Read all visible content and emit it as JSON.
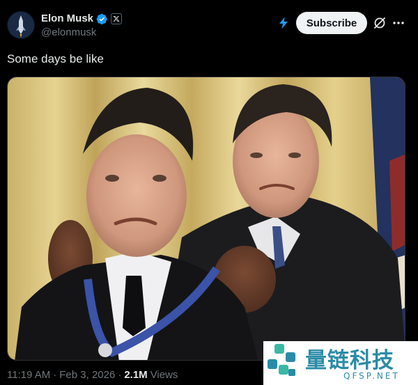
{
  "post": {
    "author": {
      "display_name": "Elon Musk",
      "handle": "@elonmusk",
      "verified_icon": "verified-badge-icon",
      "affiliation_icon": "x-logo-icon"
    },
    "actions": {
      "subscribe_label": "Subscribe",
      "grok_icon": "lightning-bolt-icon",
      "grok_action_icon": "grok-slash-icon",
      "more_icon": "more-dots-icon"
    },
    "text": "Some days be like",
    "media": {
      "description_icon": "photo"
    },
    "meta": {
      "time": "11:19 AM",
      "separator": "·",
      "date": "Feb 3, 2026",
      "views_count": "2.1M",
      "views_label": "Views"
    }
  },
  "watermark": {
    "text": "量链科技",
    "sub": "QFSP.NET"
  },
  "colors": {
    "background": "#000000",
    "primary_text": "#e7e9ea",
    "secondary_text": "#71767b",
    "verified_blue": "#1d9bf0",
    "subscribe_bg": "#eff3f4",
    "watermark": "#2a8ba6"
  }
}
